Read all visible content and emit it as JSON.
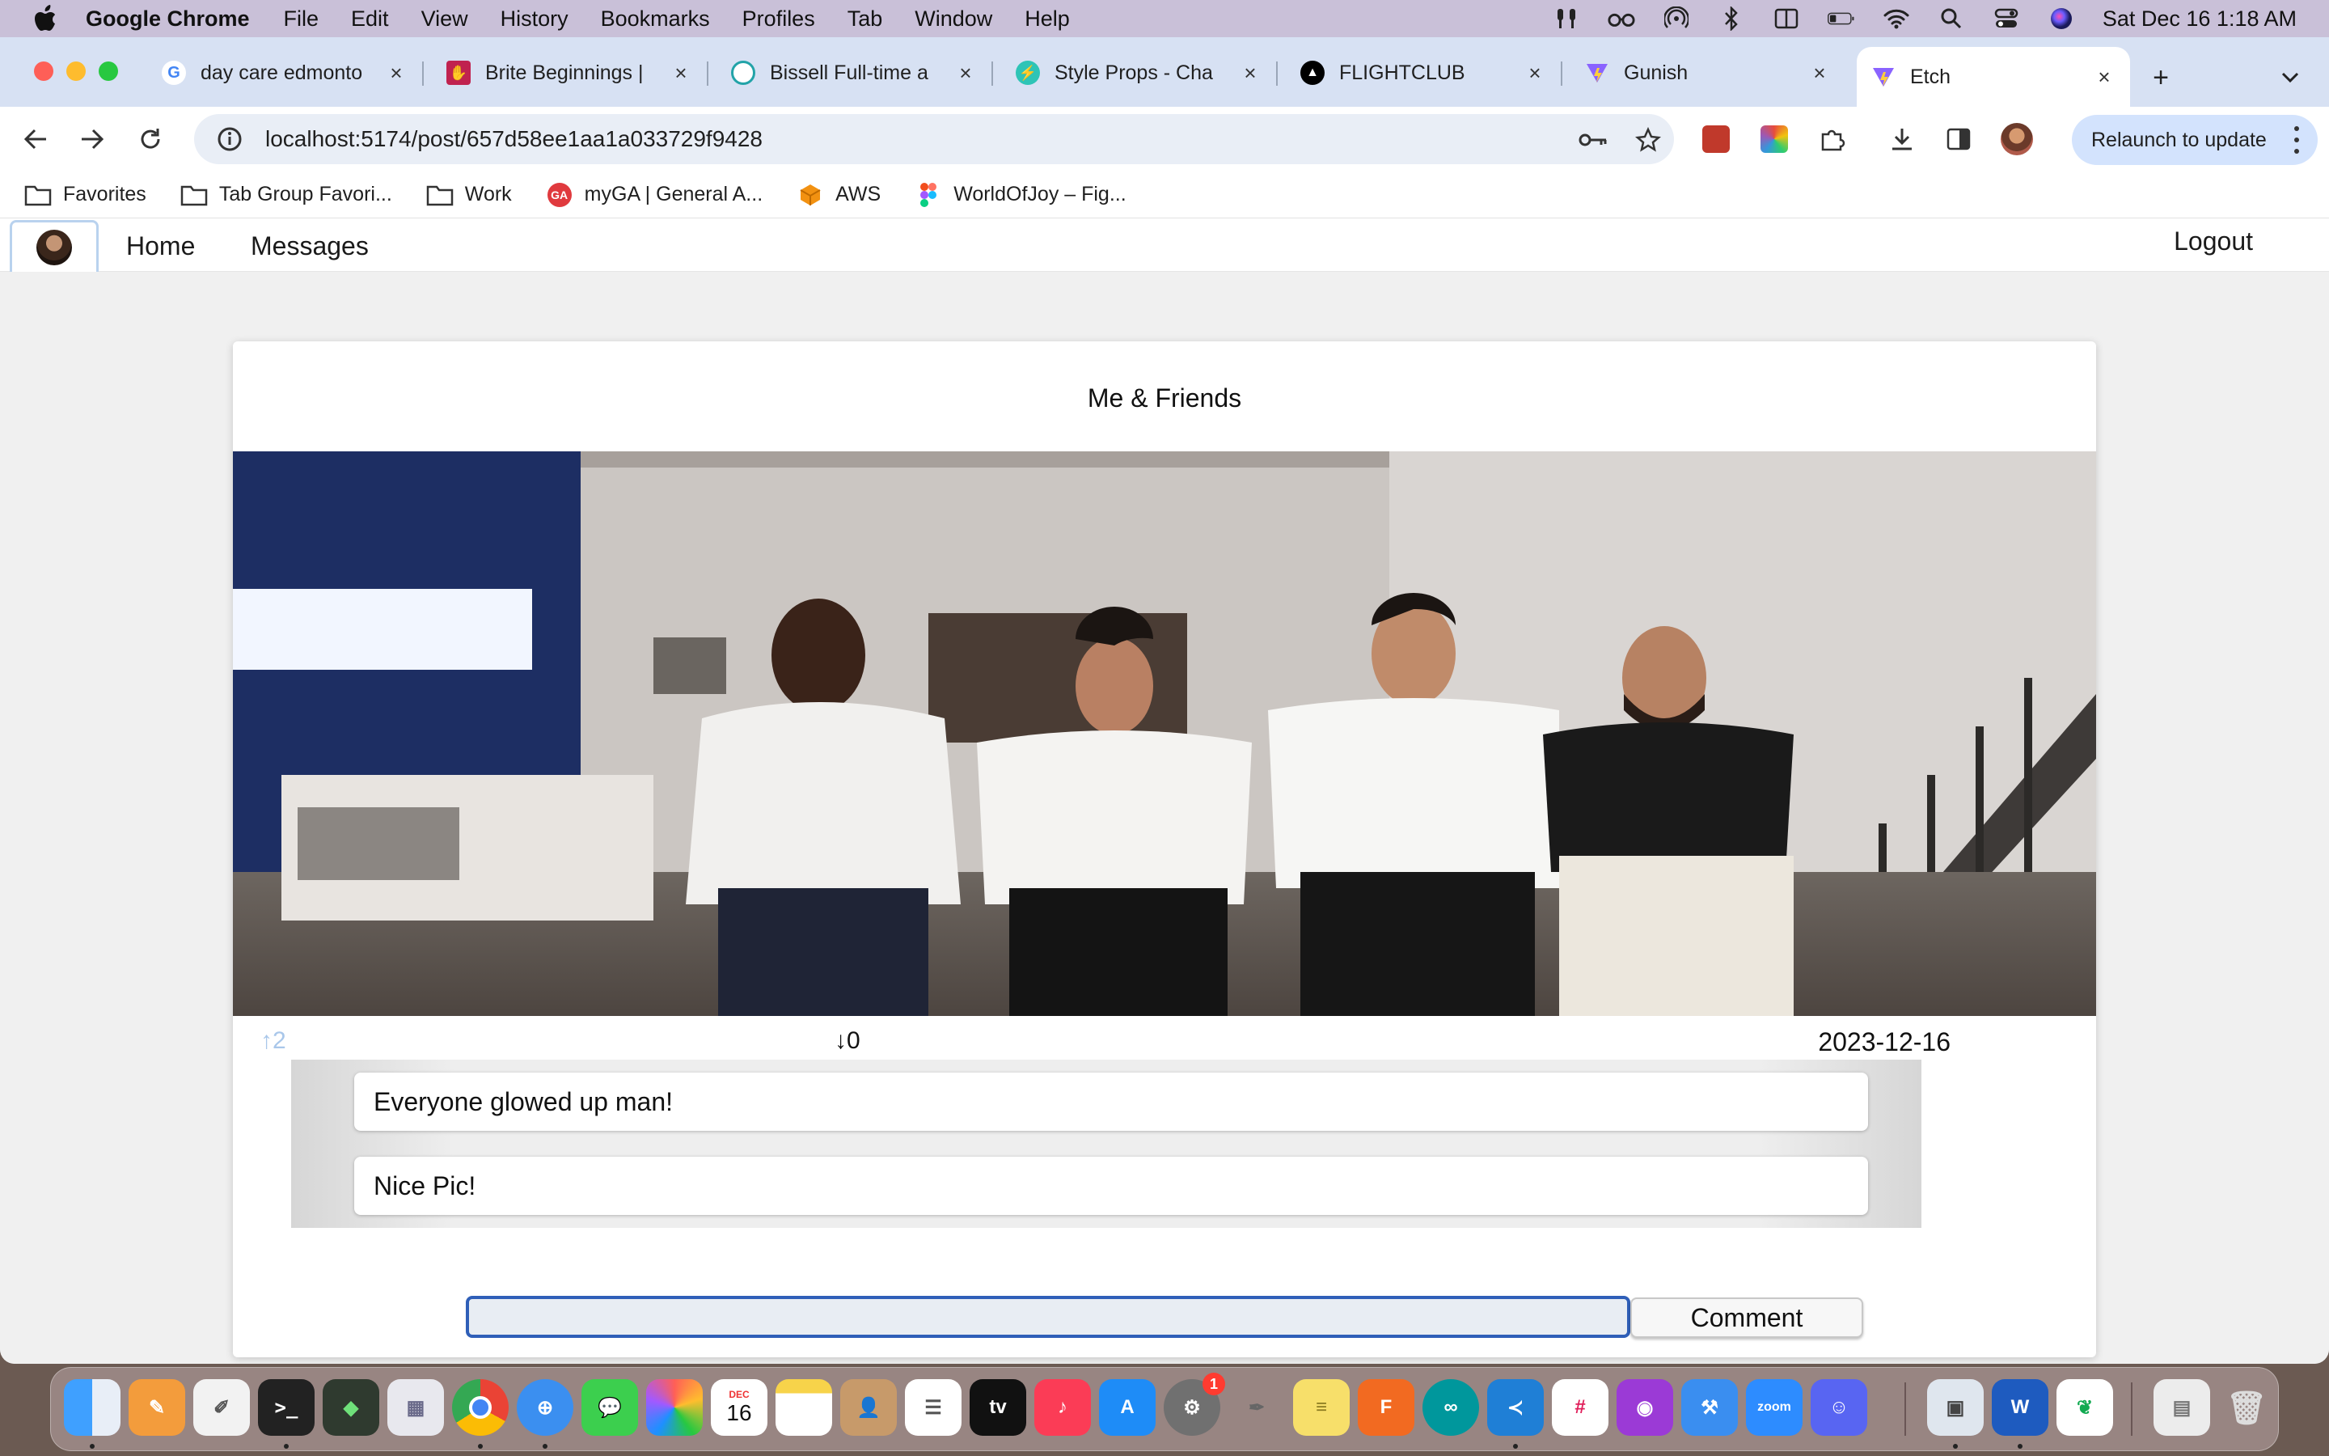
{
  "menubar": {
    "app_name": "Google Chrome",
    "items": [
      "File",
      "Edit",
      "View",
      "History",
      "Bookmarks",
      "Profiles",
      "Tab",
      "Window",
      "Help"
    ],
    "clock": "Sat Dec 16  1:18 AM",
    "status_icons": [
      "airpods-icon",
      "glasses-icon",
      "airdrop-icon",
      "bluetooth-icon",
      "mirroring-icon",
      "battery-icon",
      "wifi-icon",
      "spotlight-icon",
      "control-center-icon",
      "siri-icon"
    ]
  },
  "tabs": [
    {
      "title": "day care edmonto",
      "favicon": "google-icon",
      "active": false
    },
    {
      "title": "Brite Beginnings |",
      "favicon": "brite-icon",
      "active": false
    },
    {
      "title": "Bissell Full-time a",
      "favicon": "bissell-icon",
      "active": false
    },
    {
      "title": "Style Props - Cha",
      "favicon": "chakra-icon",
      "active": false
    },
    {
      "title": "FLIGHTCLUB",
      "favicon": "flightclub-icon",
      "active": false
    },
    {
      "title": "Gunish",
      "favicon": "vite-icon",
      "active": false
    },
    {
      "title": "Etch",
      "favicon": "vite-icon",
      "active": true
    }
  ],
  "address_bar": {
    "url": "localhost:5174/post/657d58ee1aa1a033729f9428"
  },
  "relaunch_label": "Relaunch to update",
  "bookmarks": [
    {
      "label": "Favorites",
      "icon": "folder-icon"
    },
    {
      "label": "Tab Group Favori...",
      "icon": "folder-icon"
    },
    {
      "label": "Work",
      "icon": "folder-icon"
    },
    {
      "label": "myGA | General A...",
      "icon": "ga-icon"
    },
    {
      "label": "AWS",
      "icon": "aws-icon"
    },
    {
      "label": "WorldOfJoy – Fig...",
      "icon": "figma-icon"
    }
  ],
  "app": {
    "nav": {
      "home": "Home",
      "messages": "Messages",
      "logout": "Logout"
    },
    "post": {
      "title": "Me & Friends",
      "upvotes": "2",
      "downvotes": "0",
      "date": "2023-12-16"
    },
    "comments": [
      "Everyone glowed up man!",
      "Nice Pic!"
    ],
    "comment_input": {
      "value": "",
      "placeholder": ""
    },
    "comment_button": "Comment"
  },
  "dock": {
    "calendar_month": "DEC",
    "calendar_day": "16",
    "settings_badge": "1",
    "apps": [
      "finder",
      "pages",
      "textedit",
      "terminal",
      "activity",
      "launchpad",
      "chrome",
      "safari",
      "messages",
      "photos",
      "calendar",
      "notes",
      "contacts",
      "reminders",
      "tv",
      "music",
      "app-store",
      "system-settings",
      "feather",
      "stickies",
      "fusion",
      "arduino",
      "vscode",
      "slack",
      "podcasts",
      "xcode",
      "zoom",
      "discord",
      "preview",
      "word",
      "mongodb",
      "documents",
      "trash"
    ]
  },
  "colors": {
    "accent": "#2f5fb8",
    "tabstrip": "#d7e1f3",
    "relaunch": "#d3e3fd",
    "upvote": "#a9c7ea"
  }
}
